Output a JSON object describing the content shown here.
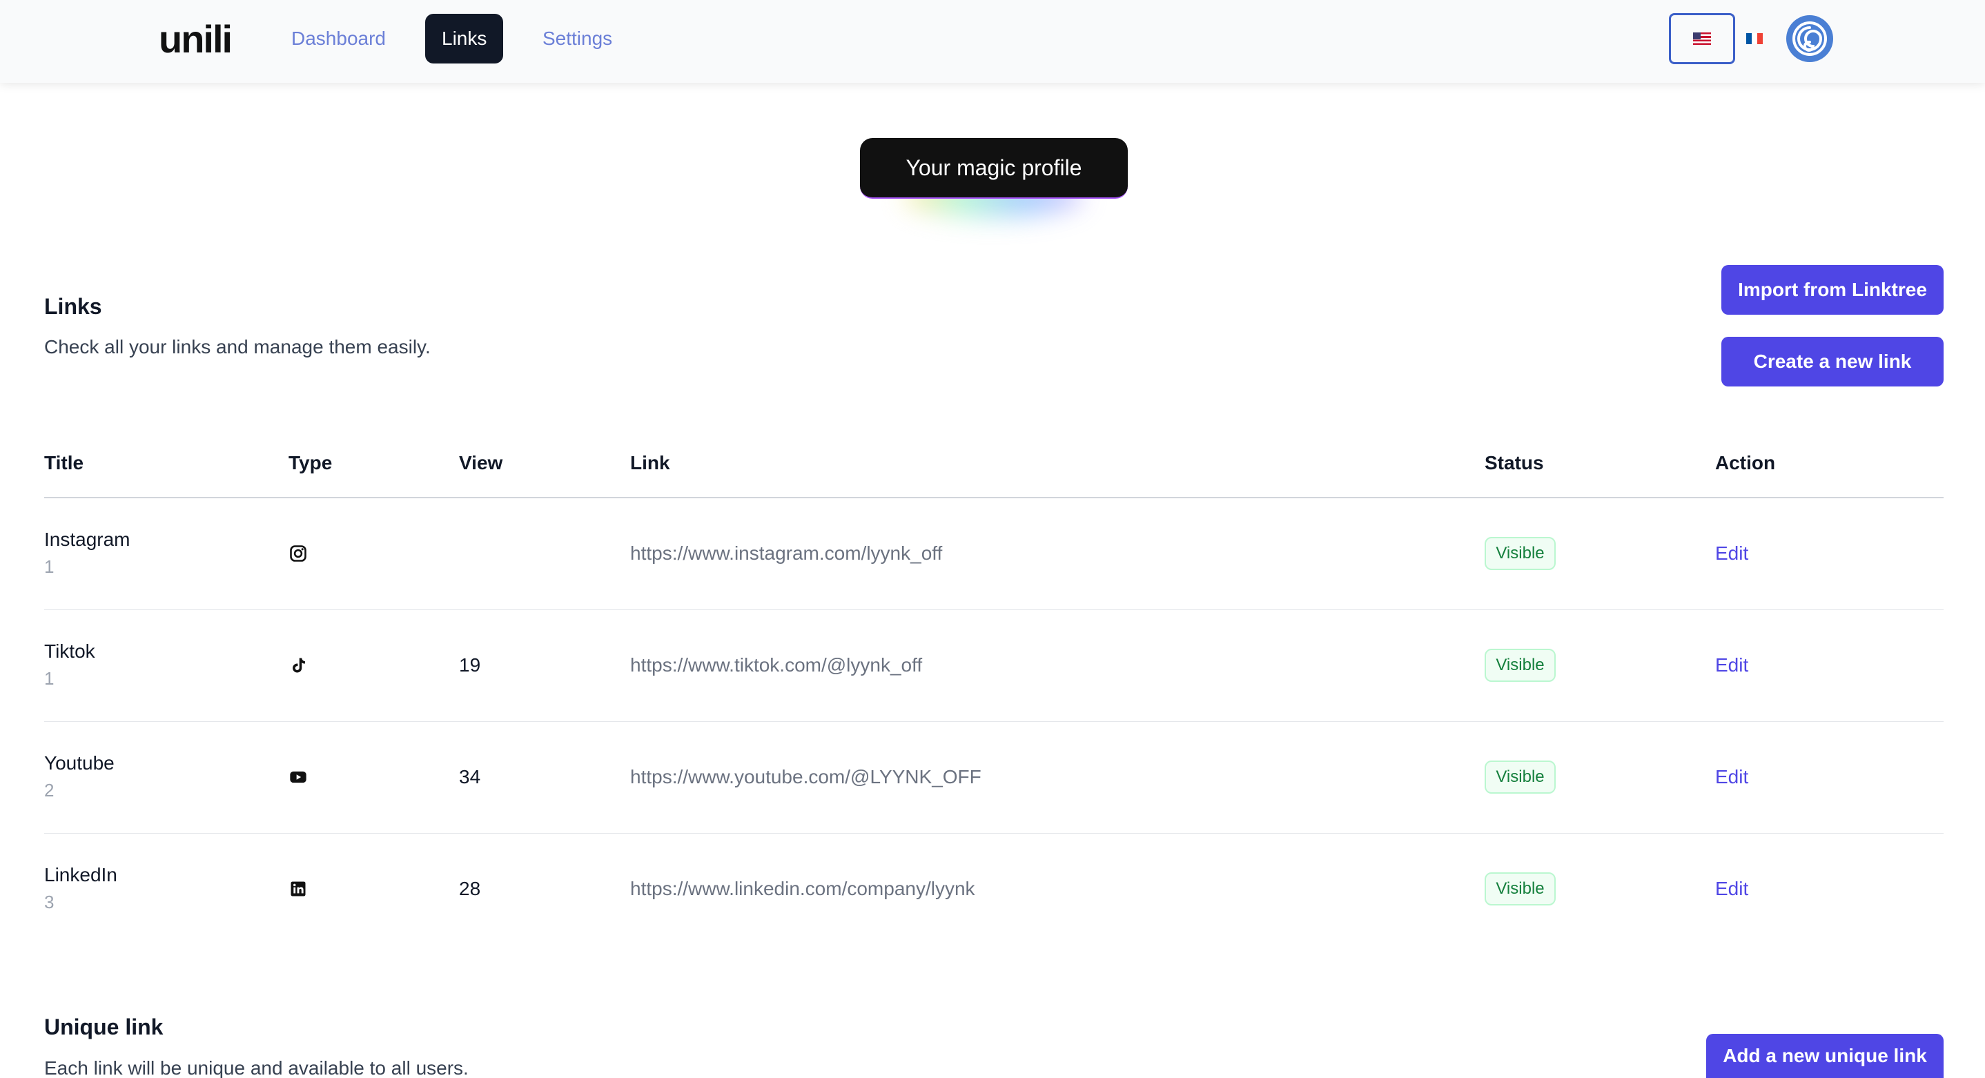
{
  "app": {
    "logo": "unili"
  },
  "nav": {
    "items": [
      {
        "label": "Dashboard",
        "active": false
      },
      {
        "label": "Links",
        "active": true
      },
      {
        "label": "Settings",
        "active": false
      }
    ]
  },
  "languages": [
    {
      "code": "en",
      "flag": "us-flag-icon",
      "selected": true
    },
    {
      "code": "fr",
      "flag": "fr-flag-icon",
      "selected": false
    }
  ],
  "magic_profile": {
    "label": "Your magic profile"
  },
  "links_section": {
    "title": "Links",
    "description": "Check all your links and manage them easily.",
    "import_label": "Import from Linktree",
    "create_label": "Create a new link"
  },
  "table": {
    "columns": [
      "Title",
      "Type",
      "View",
      "Link",
      "Status",
      "Action"
    ],
    "rows": [
      {
        "title": "Instagram",
        "order": "1",
        "type_icon": "instagram-icon",
        "view": "",
        "link": "https://www.instagram.com/lyynk_off",
        "status": "Visible",
        "action": "Edit"
      },
      {
        "title": "Tiktok",
        "order": "1",
        "type_icon": "tiktok-icon",
        "view": "19",
        "link": "https://www.tiktok.com/@lyynk_off",
        "status": "Visible",
        "action": "Edit"
      },
      {
        "title": "Youtube",
        "order": "2",
        "type_icon": "youtube-icon",
        "view": "34",
        "link": "https://www.youtube.com/@LYYNK_OFF",
        "status": "Visible",
        "action": "Edit"
      },
      {
        "title": "LinkedIn",
        "order": "3",
        "type_icon": "linkedin-icon",
        "view": "28",
        "link": "https://www.linkedin.com/company/lyynk",
        "status": "Visible",
        "action": "Edit"
      }
    ]
  },
  "unique_section": {
    "title": "Unique link",
    "description": "Each link will be unique and available to all users.",
    "add_label": "Add a new unique link"
  },
  "colors": {
    "accent": "#4f46e5",
    "nav_active_bg": "#111827",
    "nav_link": "#6b7fd7",
    "badge_green": "#15803d"
  }
}
